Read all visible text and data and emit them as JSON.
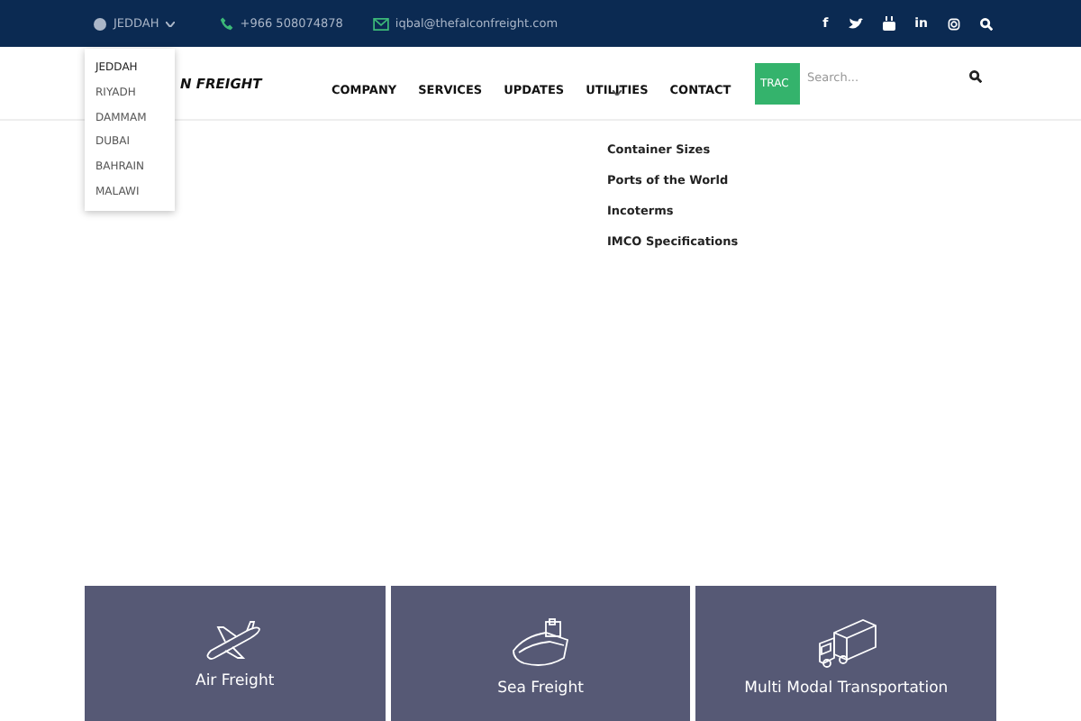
{
  "topbar": {
    "city": "JEDDAH",
    "phone": "+966 508074878",
    "email": "iqbal@thefalconfreight.com"
  },
  "city_menu": [
    {
      "label": "JEDDAH",
      "selected": true
    },
    {
      "label": "RIYADH",
      "selected": false
    },
    {
      "label": "DAMMAM",
      "selected": false
    },
    {
      "label": "DUBAI",
      "selected": false
    },
    {
      "label": "BAHRAIN",
      "selected": false
    },
    {
      "label": "MALAWI",
      "selected": false
    }
  ],
  "social_glyphs": [
    "f",
    "in"
  ],
  "logo": {
    "text": "N FREIGHT"
  },
  "nav": [
    {
      "label": "COMPANY",
      "has_submenu": false
    },
    {
      "label": "SERVICES",
      "has_submenu": false
    },
    {
      "label": "UPDATES",
      "has_submenu": false
    },
    {
      "label": "UTILITIES",
      "has_submenu": true
    },
    {
      "label": "CONTACT",
      "has_submenu": false
    }
  ],
  "track_button": "TRAC",
  "search": {
    "placeholder": "Search..."
  },
  "utilities_menu": [
    "Container Sizes",
    "Ports of the World",
    "Incoterms",
    "IMCO Specifications"
  ],
  "services": [
    {
      "kind": "plane",
      "title": "Air Freight"
    },
    {
      "kind": "ship",
      "title": "Sea Freight"
    },
    {
      "kind": "truck",
      "title": "Multi Modal Transportation"
    }
  ]
}
